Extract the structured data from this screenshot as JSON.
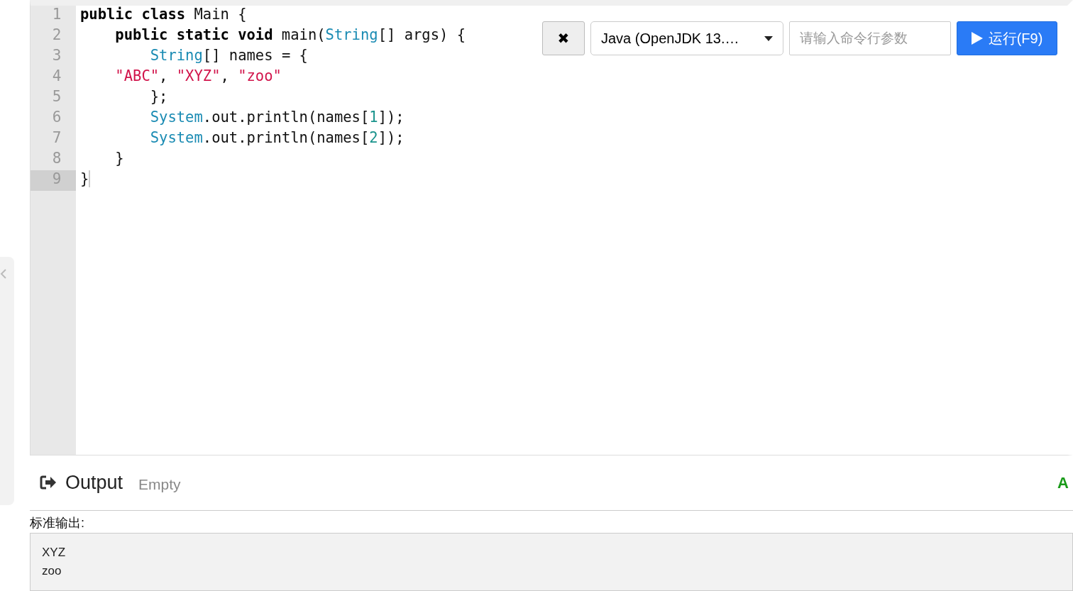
{
  "editor": {
    "lines": [
      {
        "number": "1",
        "active": false,
        "tokens": [
          {
            "kind": "keyword",
            "text": "public class"
          },
          {
            "kind": "plain",
            "text": " Main {"
          }
        ]
      },
      {
        "number": "2",
        "active": false,
        "tokens": [
          {
            "kind": "keyword",
            "text": "    public static void"
          },
          {
            "kind": "plain",
            "text": " main("
          },
          {
            "kind": "type",
            "text": "String"
          },
          {
            "kind": "plain",
            "text": "[] args) {"
          }
        ]
      },
      {
        "number": "3",
        "active": false,
        "tokens": [
          {
            "kind": "type",
            "text": "        String"
          },
          {
            "kind": "plain",
            "text": "[] names = {"
          }
        ]
      },
      {
        "number": "4",
        "active": false,
        "tokens": [
          {
            "kind": "string",
            "text": "    \"ABC\""
          },
          {
            "kind": "plain",
            "text": ", "
          },
          {
            "kind": "string",
            "text": "\"XYZ\""
          },
          {
            "kind": "plain",
            "text": ", "
          },
          {
            "kind": "string",
            "text": "\"zoo\""
          }
        ]
      },
      {
        "number": "5",
        "active": false,
        "tokens": [
          {
            "kind": "plain",
            "text": "        };"
          }
        ]
      },
      {
        "number": "6",
        "active": false,
        "tokens": [
          {
            "kind": "type",
            "text": "        System"
          },
          {
            "kind": "plain",
            "text": ".out.println(names["
          },
          {
            "kind": "number",
            "text": "1"
          },
          {
            "kind": "plain",
            "text": "]);"
          }
        ]
      },
      {
        "number": "7",
        "active": false,
        "tokens": [
          {
            "kind": "type",
            "text": "        System"
          },
          {
            "kind": "plain",
            "text": ".out.println(names["
          },
          {
            "kind": "number",
            "text": "2"
          },
          {
            "kind": "plain",
            "text": "]);"
          }
        ]
      },
      {
        "number": "8",
        "active": false,
        "tokens": [
          {
            "kind": "plain",
            "text": "    }"
          }
        ]
      },
      {
        "number": "9",
        "active": true,
        "tokens": [
          {
            "kind": "plain",
            "text": "}"
          }
        ]
      }
    ]
  },
  "toolbar": {
    "clear_button": "✖",
    "language": "Java (OpenJDK 13.…",
    "arguments": {
      "placeholder": "请输入命令行参数"
    },
    "run_button": "运行(F9)"
  },
  "output": {
    "title": "Output",
    "status": "Empty",
    "right_text": "A",
    "stdout_label": "标准输出:",
    "stdout_lines": [
      "XYZ",
      "zoo"
    ]
  }
}
